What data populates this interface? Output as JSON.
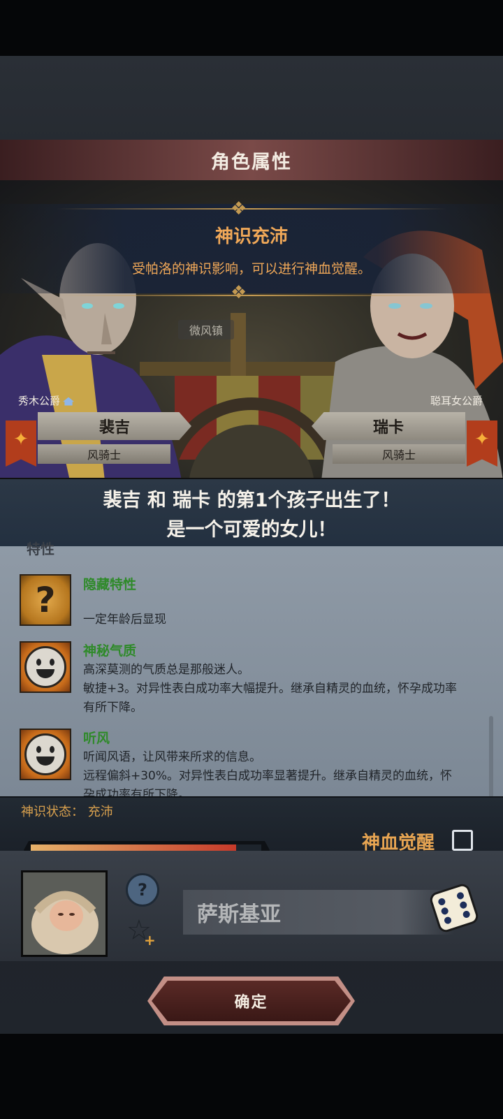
{
  "header": {
    "title": "角色属性"
  },
  "notice": {
    "title": "神识充沛",
    "description": "受帕洛的神识影响，可以进行神血觉醒。"
  },
  "map": {
    "location_label": "微风镇"
  },
  "parents": {
    "father": {
      "rank": "秀木公爵",
      "name": "裴吉",
      "class": "风骑士"
    },
    "mother": {
      "rank": "聪耳女公爵",
      "name": "瑞卡",
      "class": "风骑士"
    }
  },
  "announcement": {
    "line1": "裴吉 和 瑞卡 的第1个孩子出生了！",
    "line2": "是一个可爱的女儿！"
  },
  "traits": {
    "header": "特性",
    "items": [
      {
        "icon": "question-icon",
        "name": "隐藏特性",
        "lines": [
          "一定年龄后显现"
        ]
      },
      {
        "icon": "smile-face-icon",
        "name": "神秘气质",
        "lines": [
          "高深莫测的气质总是那般迷人。",
          "敏捷+3。对异性表白成功率大幅提升。继承自精灵的血统，怀孕成功率",
          "有所下降。"
        ]
      },
      {
        "icon": "smile-face-icon",
        "name": "听风",
        "lines": [
          "听闻风语，让风带来所求的信息。",
          "远程偏斜+30%。对异性表白成功率显著提升。继承自精灵的血统，怀",
          "孕成功率有所下降。"
        ]
      }
    ]
  },
  "status": {
    "label": "神识状态：",
    "value": "充沛",
    "progress_percent": 89,
    "awaken_label": "神血觉醒",
    "awaken_checked": false
  },
  "child": {
    "name": "萨斯基亚",
    "help_icon": "question-circle-icon",
    "favorite_icon": "star-plus-icon",
    "random_icon": "dice-icon"
  },
  "confirm_label": "确定",
  "colors": {
    "accent_orange": "#f0a858",
    "trait_green": "#2f8a2a",
    "title_bar": "#7a4a48"
  }
}
